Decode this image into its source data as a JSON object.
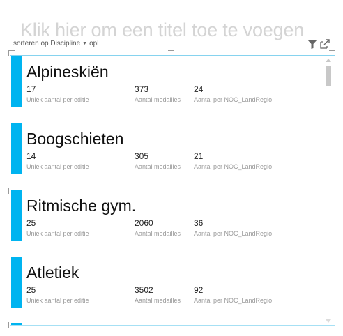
{
  "visual": {
    "title_placeholder": "Klik hier om een titel toe te voegen",
    "sort": {
      "label": "sorteren op Discipline",
      "order": "opl"
    }
  },
  "cards": [
    {
      "name": "Alpineskiën",
      "stats": [
        {
          "value": "17",
          "label": "Uniek aantal per editie"
        },
        {
          "value": "373",
          "label": "Aantal medailles"
        },
        {
          "value": "24",
          "label": "Aantal per NOC_LandRegio"
        }
      ]
    },
    {
      "name": "Boogschieten",
      "stats": [
        {
          "value": "14",
          "label": "Uniek aantal per editie"
        },
        {
          "value": "305",
          "label": "Aantal medailles"
        },
        {
          "value": "21",
          "label": "Aantal per NOC_LandRegio"
        }
      ]
    },
    {
      "name": "Ritmische gym.",
      "stats": [
        {
          "value": "25",
          "label": "Uniek aantal per editie"
        },
        {
          "value": "2060",
          "label": "Aantal medailles"
        },
        {
          "value": "36",
          "label": "Aantal per NOC_LandRegio"
        }
      ]
    },
    {
      "name": "Atletiek",
      "stats": [
        {
          "value": "25",
          "label": "Uniek aantal per editie"
        },
        {
          "value": "3502",
          "label": "Aantal medailles"
        },
        {
          "value": "92",
          "label": "Aantal per NOC_LandRegio"
        }
      ]
    }
  ],
  "colors": {
    "accent_bar": "#00b4f0",
    "card_divider": "#86d3ef",
    "title_placeholder": "#d4d4d4"
  },
  "icons": {
    "filter": "filter-icon",
    "focus_mode": "popout-icon"
  }
}
